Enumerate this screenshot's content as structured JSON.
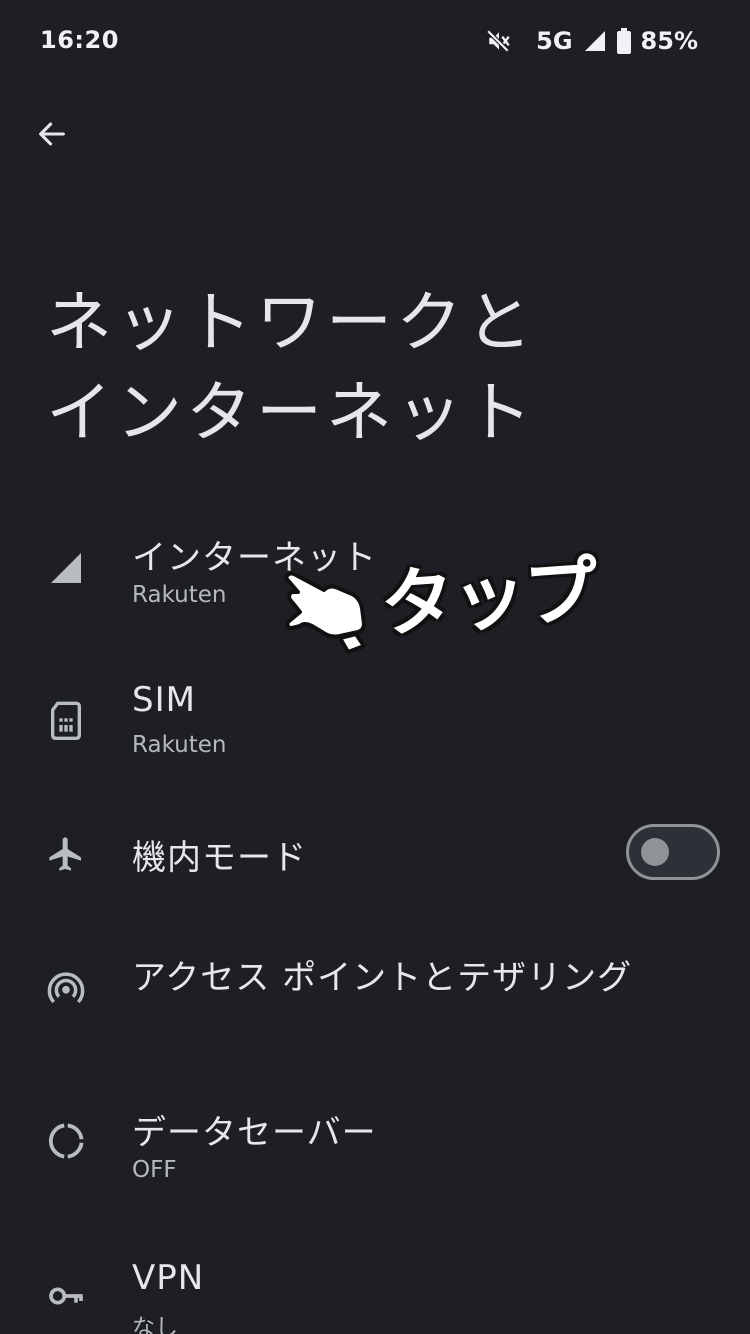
{
  "status_bar": {
    "time": "16:20",
    "network": "5G",
    "battery": "85%",
    "icons": [
      "mute-icon",
      "signal-icon",
      "battery-icon"
    ]
  },
  "header": {
    "back_icon": "arrow-left-icon",
    "title_line1": "ネットワークと",
    "title_line2": "インターネット"
  },
  "settings": {
    "internet": {
      "title": "インターネット",
      "subtitle": "Rakuten",
      "icon": "signal-icon"
    },
    "sim": {
      "title": "SIM",
      "subtitle": "Rakuten",
      "icon": "sim-card-icon"
    },
    "airplane": {
      "title": "機内モード",
      "icon": "airplane-icon",
      "enabled": false
    },
    "hotspot": {
      "title": "アクセス ポイントとテザリング",
      "icon": "hotspot-icon"
    },
    "data_saver": {
      "title": "データセーバー",
      "subtitle": "OFF",
      "icon": "data-saver-icon"
    },
    "vpn": {
      "title": "VPN",
      "subtitle": "なし",
      "icon": "key-icon"
    }
  },
  "annotation": {
    "label": "タップ",
    "icon": "pointing-hand-icon"
  },
  "colors": {
    "background": "#1d1f24",
    "text": "#e7e7ea",
    "subtext": "#b5b8bd",
    "toggle": "#8f9296"
  }
}
